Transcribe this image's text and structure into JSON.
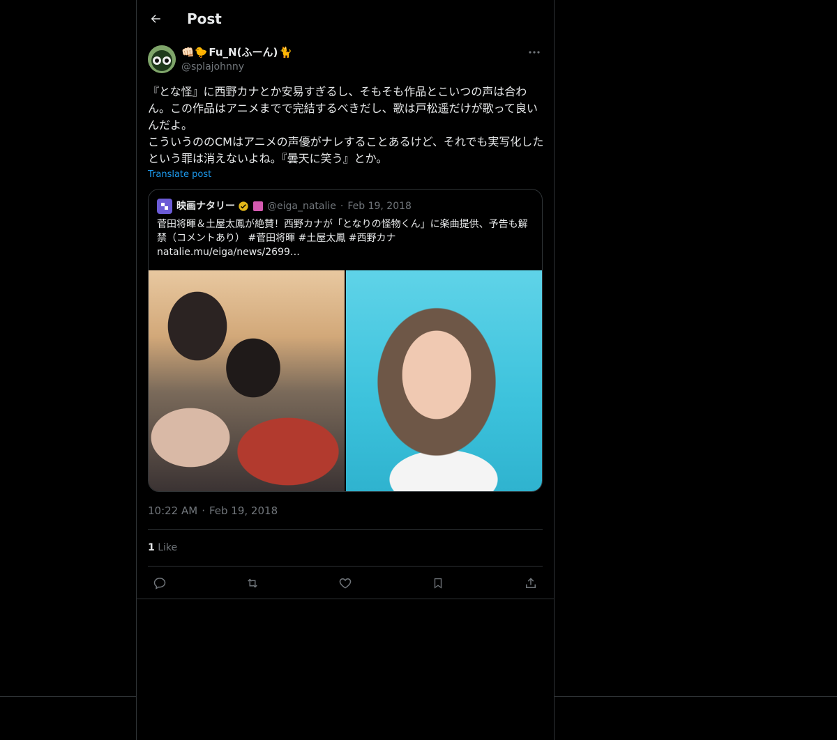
{
  "header": {
    "title": "Post"
  },
  "post": {
    "author": {
      "display_name": "Fu_N(ふーん)",
      "display_prefix_emoji": "👊🏻🐤",
      "display_suffix_emoji": "🐈",
      "handle": "@splajohnny"
    },
    "text": "『とな怪』に西野カナとか安易すぎるし、そもそも作品とこいつの声は合わん。この作品はアニメまでで完結するべきだし、歌は戸松遥だけが歌って良いんだよ。\nこういうののCMはアニメの声優がナレすることあるけど、それでも実写化したという罪は消えないよね。『曇天に笑う』とか。",
    "translate_label": "Translate post",
    "time": "10:22 AM",
    "date": "Feb 19, 2018",
    "likes_count": "1",
    "likes_label": "Like"
  },
  "quote": {
    "name": "映画ナタリー",
    "handle": "@eiga_natalie",
    "separator": "·",
    "date": "Feb 19, 2018",
    "text": "菅田将暉＆土屋太鳳が絶賛！西野カナが「となりの怪物くん」に楽曲提供、予告も解禁（コメントあり） #菅田将暉 #土屋太鳳 #西野カナ",
    "link": "natalie.mu/eiga/news/2699…"
  },
  "timestamp_separator": "·",
  "icons": {
    "back": "back-arrow-icon",
    "more": "more-icon",
    "reply": "reply-icon",
    "repost": "repost-icon",
    "like": "heart-icon",
    "bookmark": "bookmark-icon",
    "share": "share-icon",
    "verified": "verified-badge-icon"
  },
  "colors": {
    "accent": "#1d9bf0",
    "verified": "#e2b719",
    "muted": "#71767b"
  }
}
